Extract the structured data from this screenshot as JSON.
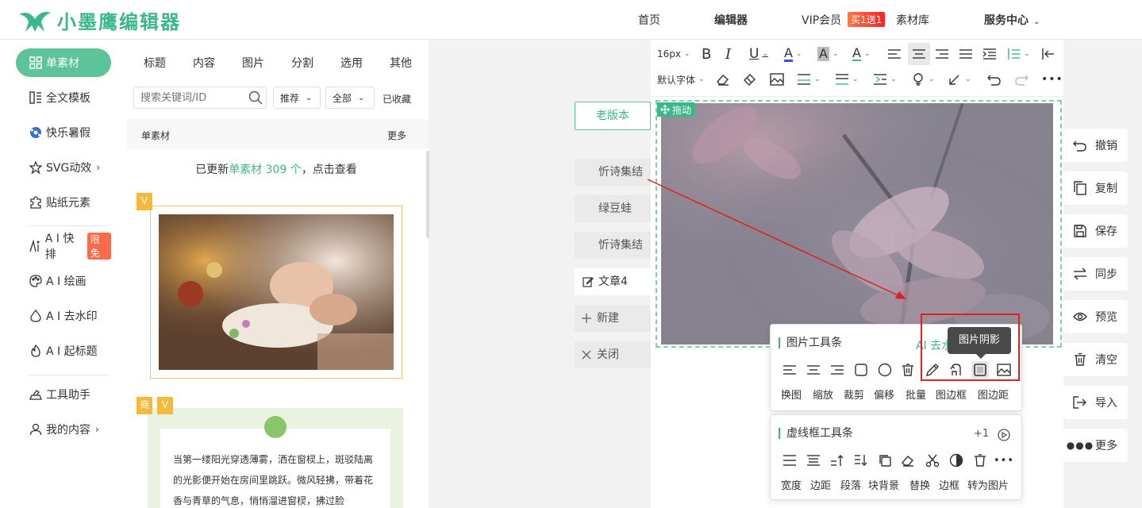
{
  "header": {
    "logo_text": "小墨鹰编辑器",
    "nav": [
      "首页",
      "编辑器",
      "VIP会员",
      "素材库",
      "服务中心"
    ],
    "vip_badge": "买1送1"
  },
  "sidebar": {
    "items": [
      {
        "label": "单素材",
        "icon": "grid-icon"
      },
      {
        "label": "全文模板",
        "icon": "template-icon"
      },
      {
        "label": "快乐暑假",
        "icon": "ball-icon"
      },
      {
        "label": "SVG动效",
        "icon": "star-icon"
      },
      {
        "label": "贴纸元素",
        "icon": "puzzle-icon"
      },
      {
        "label": "A I 快排",
        "icon": "ai-layout-icon",
        "badge": "限免"
      },
      {
        "label": "A I 绘画",
        "icon": "palette-icon"
      },
      {
        "label": "A I 去水印",
        "icon": "drop-icon"
      },
      {
        "label": "A I 起标题",
        "icon": "flame-icon"
      },
      {
        "label": "工具助手",
        "icon": "tools-icon"
      },
      {
        "label": "我的内容",
        "icon": "user-icon"
      }
    ]
  },
  "panel": {
    "tabs": [
      "标题",
      "内容",
      "图片",
      "分割",
      "选用",
      "其他"
    ],
    "search_placeholder": "搜索关键词/ID",
    "sort_value": "推荐",
    "filter_value": "全部",
    "collected": "已收藏",
    "section_title": "单素材",
    "section_more": "更多",
    "update_prefix": "已更新",
    "update_highlight": "单素材 309 个",
    "update_suffix": "，点击查看",
    "badge_v": "V",
    "badge_shang": "商",
    "card2_text": "当第一缕阳光穿透薄雾，洒在窗棂上，斑驳陆离的光影便开始在房间里跳跃。微风轻拂，带着花香与青草的气息，悄悄溜进窗棂，拂过脸"
  },
  "middle": {
    "old_version": "老版本",
    "articles": [
      "忻诗集结",
      "绿豆蛙",
      "忻诗集结"
    ],
    "current": "文章4",
    "new_label": "新建",
    "close_label": "关闭"
  },
  "editor": {
    "font_size": "16px",
    "font_family": "默认字体",
    "drag_label": "拖动"
  },
  "image_toolbar": {
    "title": "图片工具条",
    "ai_label": "AI 去水",
    "tooltip": "图片阴影",
    "labels": [
      "换图",
      "缩放",
      "裁剪",
      "偏移",
      "批量",
      "图边框",
      "图边距"
    ]
  },
  "dash_toolbar": {
    "title": "虚线框工具条",
    "plus": "+1",
    "labels": [
      "宽度",
      "边距",
      "段落",
      "块背景",
      "替换",
      "边框",
      "转为图片"
    ]
  },
  "actions": [
    "撤销",
    "复制",
    "保存",
    "同步",
    "预览",
    "清空",
    "导入",
    "更多"
  ],
  "colors": {
    "accent": "#3ab88a",
    "highlight": "#e02020"
  }
}
